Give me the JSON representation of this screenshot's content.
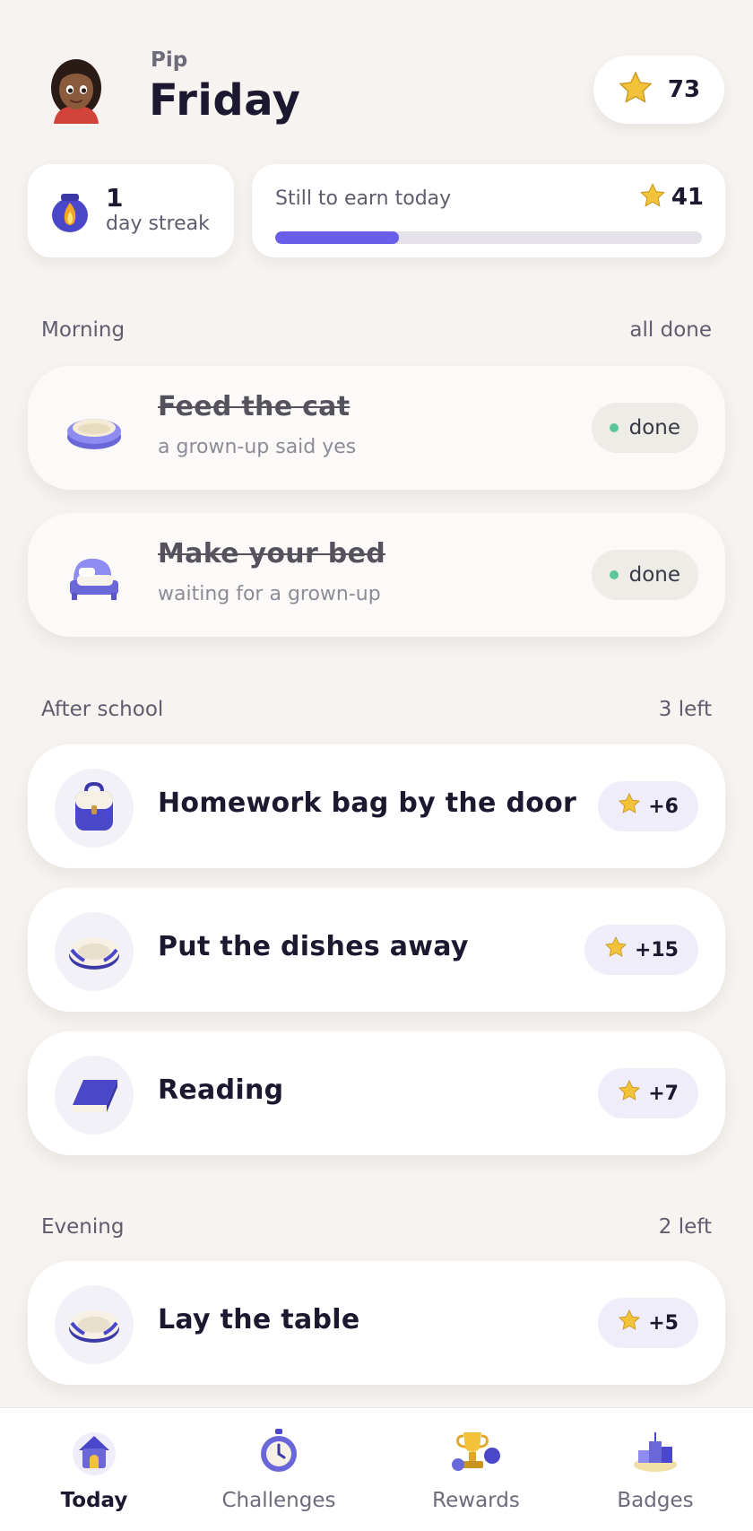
{
  "header": {
    "kid_name": "Pip",
    "day": "Friday",
    "star_total": "73"
  },
  "streak": {
    "count": "1",
    "label": "day streak"
  },
  "earn": {
    "label": "Still to earn today",
    "stars": "41",
    "progress_fraction": 0.29
  },
  "sections": [
    {
      "title": "Morning",
      "status": "all done",
      "tasks": [
        {
          "name": "Feed the cat",
          "note": "a grown-up said yes",
          "state": "done",
          "state_label": "done",
          "icon": "pet-bowl-icon"
        },
        {
          "name": "Make your bed",
          "note": "waiting for a grown-up",
          "state": "done",
          "state_label": "done",
          "icon": "bed-icon"
        }
      ]
    },
    {
      "title": "After school",
      "status": "3 left",
      "tasks": [
        {
          "name": "Homework bag by the door",
          "reward": "+6",
          "icon": "backpack-icon"
        },
        {
          "name": "Put the dishes away",
          "reward": "+15",
          "icon": "dishes-icon"
        },
        {
          "name": "Reading",
          "reward": "+7",
          "icon": "book-icon"
        }
      ]
    },
    {
      "title": "Evening",
      "status": "2 left",
      "tasks": [
        {
          "name": "Lay the table",
          "reward": "+5",
          "icon": "plate-icon"
        }
      ]
    }
  ],
  "tabs": [
    {
      "label": "Today",
      "active": true,
      "icon": "house-icon"
    },
    {
      "label": "Challenges",
      "active": false,
      "icon": "stopwatch-icon"
    },
    {
      "label": "Rewards",
      "active": false,
      "icon": "trophy-icon"
    },
    {
      "label": "Badges",
      "active": false,
      "icon": "podium-icon"
    }
  ],
  "colors": {
    "accent": "#6a5ee8",
    "star": "#f2c33a",
    "done_dot": "#5cc69a",
    "background": "#f6f3f0"
  }
}
